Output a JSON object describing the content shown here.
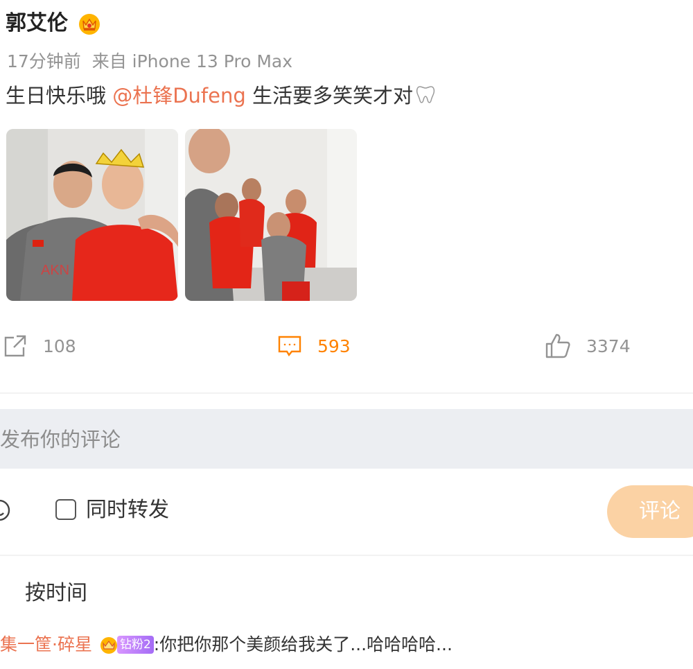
{
  "post": {
    "author": "郭艾伦",
    "time": "17分钟前",
    "source": "来自 iPhone 13 Pro Max",
    "text_before": "生日快乐哦 ",
    "mention": "@杜锋Dufeng",
    "text_after": "  生活要多笑笑才对"
  },
  "actions": {
    "repost_count": "108",
    "comment_count": "593",
    "like_count": "3374"
  },
  "comment_input": {
    "placeholder": "发布你的评论",
    "repost_checkbox_label": "同时转发",
    "submit_label": "评论"
  },
  "sort": {
    "label": "按时间"
  },
  "comments": [
    {
      "user": "集一筐·碎星",
      "badge": "钻粉2",
      "text": ":你把你那个美颜给我关了...哈哈哈哈..."
    }
  ],
  "colors": {
    "accent": "#ff8200",
    "mention": "#eb7350",
    "submit_button": "#fbd2a4",
    "input_bg": "#eceef2"
  },
  "icons": [
    "crown-icon",
    "tooth-emoji-icon",
    "repost-icon",
    "comment-icon",
    "like-icon",
    "emoji-icon",
    "diamond-fan-icon"
  ]
}
